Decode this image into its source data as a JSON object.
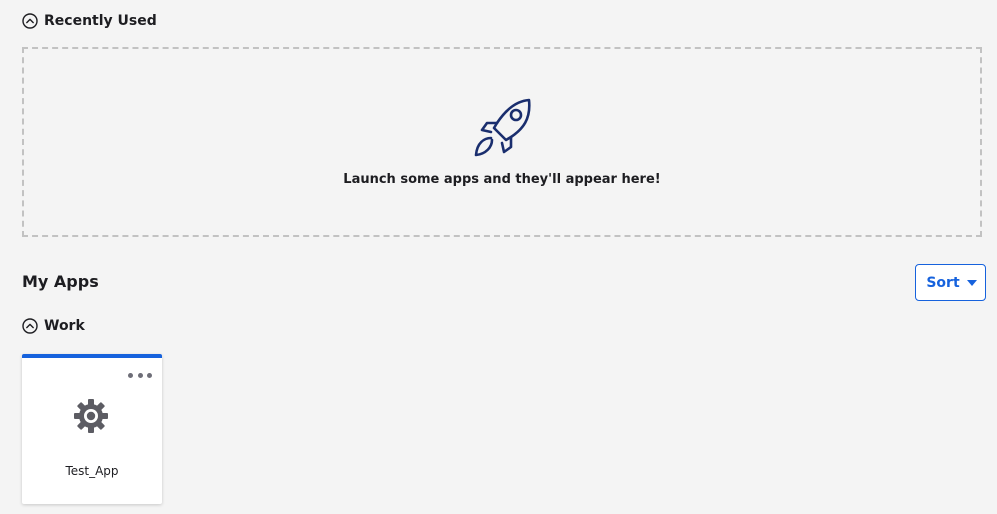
{
  "recently_used": {
    "title": "Recently Used",
    "empty_message": "Launch some apps and they'll appear here!"
  },
  "my_apps": {
    "title": "My Apps",
    "sort_label": "Sort",
    "groups": [
      {
        "title": "Work",
        "apps": [
          {
            "name": "Test_App",
            "icon": "gear-icon"
          }
        ]
      }
    ]
  },
  "colors": {
    "background": "#f4f4f4",
    "accent": "#1662dd",
    "rocket": "#1a2e6e",
    "text": "#1d1d21"
  },
  "icons": {
    "collapse": "chevron-up-circle-icon",
    "empty_state": "rocket-icon",
    "sort_caret": "caret-down-icon",
    "tile_menu": "more-horizontal-icon"
  }
}
